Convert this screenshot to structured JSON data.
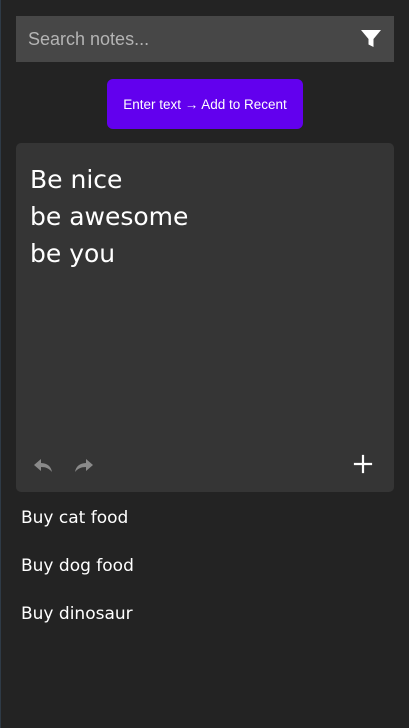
{
  "search": {
    "placeholder": "Search notes...",
    "filter_icon": "filter-icon"
  },
  "toolbar": {
    "add_recent_label": "Enter text → Add to Recent",
    "accent_color": "#6200ee"
  },
  "editor": {
    "lines": [
      "Be nice",
      "be awesome",
      "be you"
    ],
    "undo_icon": "undo-icon",
    "redo_icon": "redo-icon",
    "add_icon": "plus-icon"
  },
  "recent": {
    "items": [
      {
        "label": "Buy cat food"
      },
      {
        "label": "Buy dog food"
      },
      {
        "label": "Buy dinosaur"
      }
    ]
  },
  "colors": {
    "background": "#232323",
    "search_bar": "#474747",
    "editor_card": "#353535"
  }
}
